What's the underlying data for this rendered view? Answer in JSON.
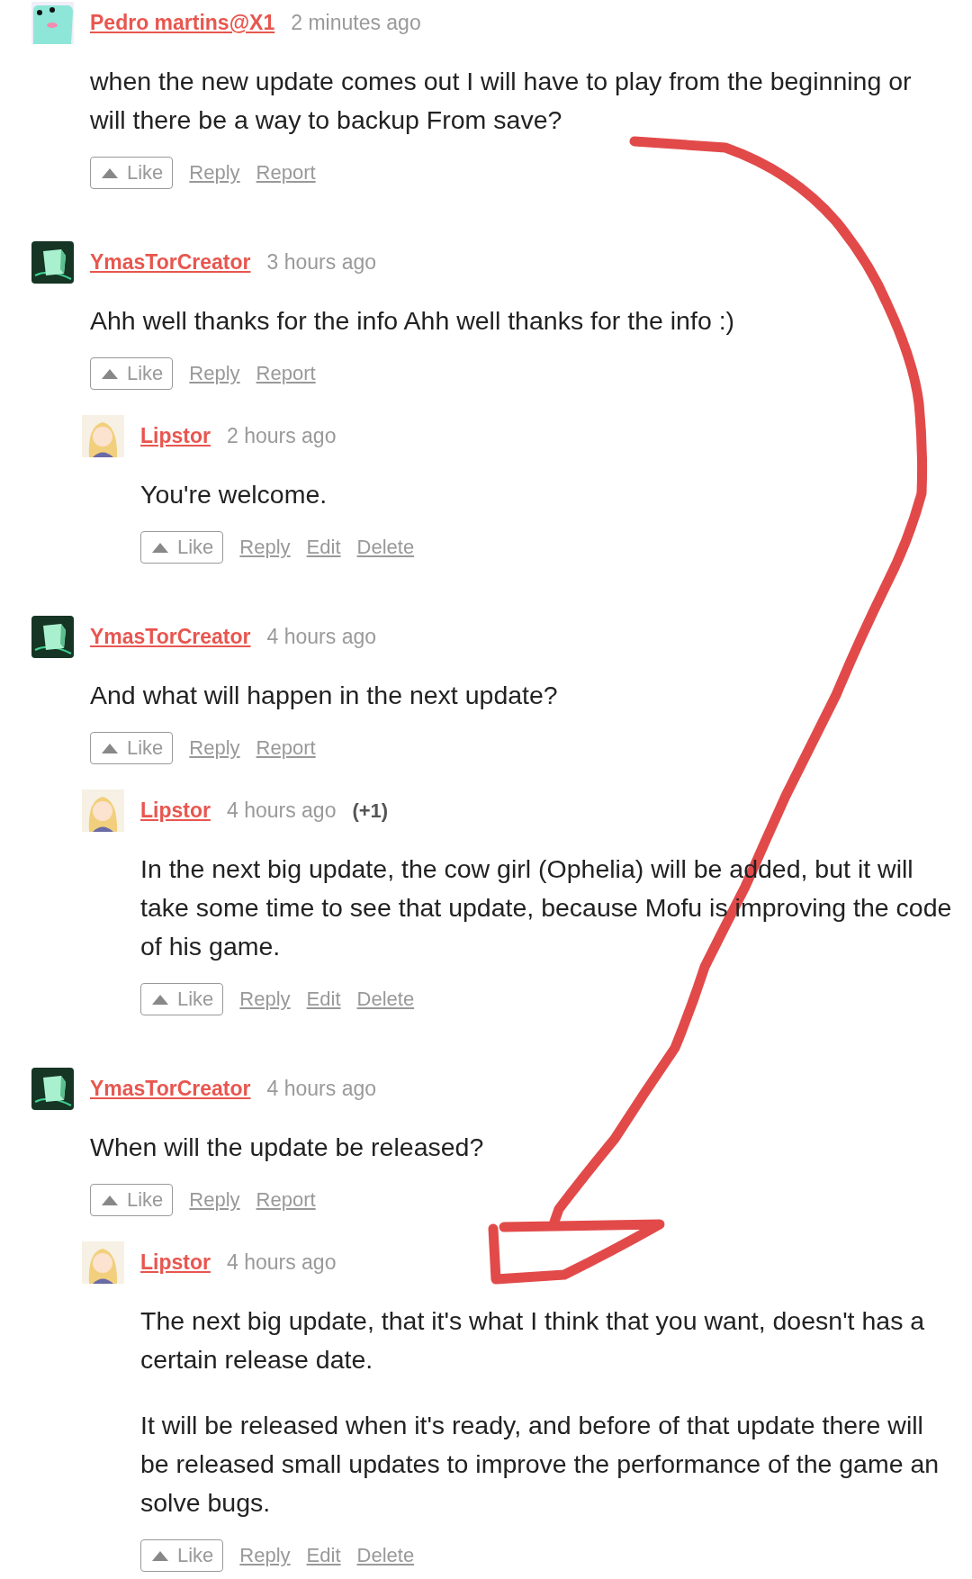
{
  "comments": [
    {
      "avatar": {
        "kind": "frog"
      },
      "author": "Pedro martins@X1",
      "time": "2 minutes ago",
      "paragraphs": [
        [
          "when the new update comes out I will have to play from the beginning or",
          "will there be a way to backup From save?"
        ]
      ],
      "actions": [
        {
          "kind": "vote",
          "label": "Like"
        },
        {
          "kind": "link",
          "label": "Reply"
        },
        {
          "kind": "link",
          "label": "Report"
        }
      ]
    },
    {
      "avatar": {
        "kind": "cube"
      },
      "author": "YmasTorCreator",
      "time": "3 hours ago",
      "paragraphs": [
        [
          "Ahh well thanks for the info Ahh well thanks for the info :)"
        ]
      ],
      "actions": [
        {
          "kind": "vote",
          "label": "Like"
        },
        {
          "kind": "link",
          "label": "Reply"
        },
        {
          "kind": "link",
          "label": "Report"
        }
      ],
      "replies": [
        {
          "avatar": {
            "kind": "portrait"
          },
          "author": "Lipstor",
          "time": "2 hours ago",
          "paragraphs": [
            [
              "You're welcome."
            ]
          ],
          "actions": [
            {
              "kind": "vote",
              "label": "Like"
            },
            {
              "kind": "link",
              "label": "Reply"
            },
            {
              "kind": "link",
              "label": "Edit"
            },
            {
              "kind": "link",
              "label": "Delete"
            }
          ]
        }
      ]
    },
    {
      "avatar": {
        "kind": "cube"
      },
      "author": "YmasTorCreator",
      "time": "4 hours ago",
      "paragraphs": [
        [
          "And what will happen in the next update?"
        ]
      ],
      "actions": [
        {
          "kind": "vote",
          "label": "Like"
        },
        {
          "kind": "link",
          "label": "Reply"
        },
        {
          "kind": "link",
          "label": "Report"
        }
      ],
      "replies": [
        {
          "avatar": {
            "kind": "portrait"
          },
          "author": "Lipstor",
          "time": "4 hours ago",
          "score": "(+1)",
          "paragraphs": [
            [
              "In the next big update, the cow girl (Ophelia) will be added, but it will",
              "take some time to see that update, because Mofu is improving the code",
              "of his game."
            ]
          ],
          "actions": [
            {
              "kind": "vote",
              "label": "Like"
            },
            {
              "kind": "link",
              "label": "Reply"
            },
            {
              "kind": "link",
              "label": "Edit"
            },
            {
              "kind": "link",
              "label": "Delete"
            }
          ]
        }
      ]
    },
    {
      "avatar": {
        "kind": "cube"
      },
      "author": "YmasTorCreator",
      "time": "4 hours ago",
      "paragraphs": [
        [
          "When will the update be released?"
        ]
      ],
      "actions": [
        {
          "kind": "vote",
          "label": "Like"
        },
        {
          "kind": "link",
          "label": "Reply"
        },
        {
          "kind": "link",
          "label": "Report"
        }
      ],
      "replies": [
        {
          "avatar": {
            "kind": "portrait"
          },
          "author": "Lipstor",
          "time": "4 hours ago",
          "paragraphs": [
            [
              "The next big update, that it's what I think that you want, doesn't has a",
              "certain release date."
            ],
            [
              "It will be released when it's ready, and before of that update there will",
              "be released small updates to improve the performance of the game an",
              "solve bugs."
            ]
          ],
          "actions": [
            {
              "kind": "vote",
              "label": "Like"
            },
            {
              "kind": "link",
              "label": "Reply"
            },
            {
              "kind": "link",
              "label": "Edit"
            },
            {
              "kind": "link",
              "label": "Delete"
            }
          ]
        }
      ]
    }
  ]
}
